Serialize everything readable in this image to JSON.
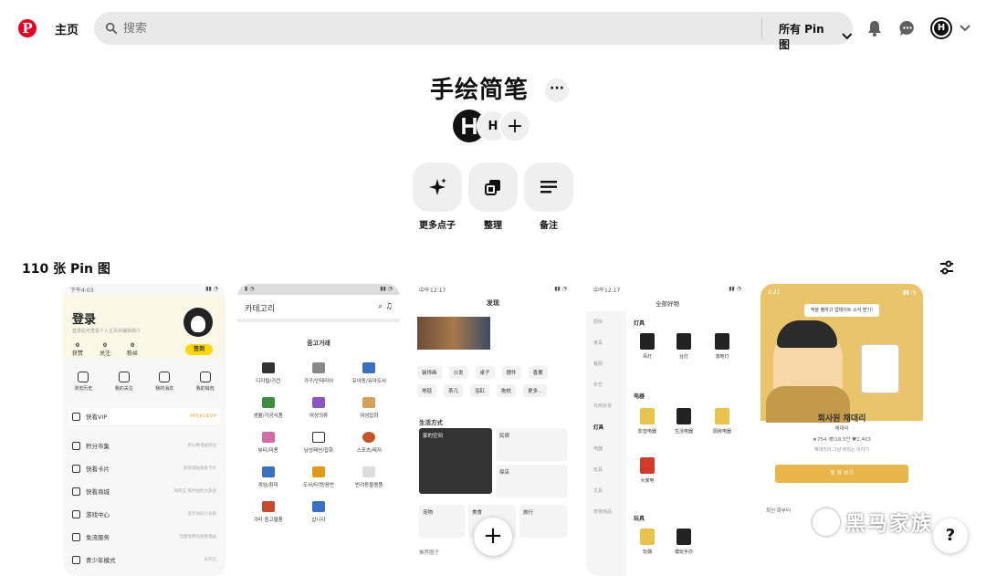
{
  "header": {
    "logo": "P",
    "home_label": "主页",
    "search_placeholder": "搜索",
    "filter_label": "所有 Pin 图",
    "avatar_initial": "H"
  },
  "board": {
    "title": "手绘简笔",
    "more_label": "···",
    "collaborators": [
      "H",
      "H"
    ],
    "add_collaborator": "+",
    "actions": [
      {
        "label": "更多点子",
        "icon": "sparkle-icon"
      },
      {
        "label": "整理",
        "icon": "organize-icon"
      },
      {
        "label": "备注",
        "icon": "notes-icon"
      }
    ],
    "pin_count": "110 张 Pin 图"
  },
  "pins": {
    "p1": {
      "status": "下午4:03",
      "title": "登录",
      "subtitle": "登录后可查看个人主页并编辑简介",
      "sign_label": "签到",
      "stats": [
        {
          "v": "0",
          "l": "获赞"
        },
        {
          "v": "0",
          "l": "关注"
        },
        {
          "v": "0",
          "l": "粉丝"
        }
      ],
      "shortcuts": [
        "浏览历史",
        "我的关注",
        "我的消息",
        "我的钱包"
      ],
      "vip_label": "快看VIP",
      "vip_hint": "99元买1年VIP",
      "menu": [
        {
          "label": "积分市集",
          "hint": "积分换漫画周边"
        },
        {
          "label": "快看卡片",
          "hint": "解锁漫画独家卡片"
        },
        {
          "label": "快看商城",
          "hint": "每周五 限时福利大放送"
        },
        {
          "label": "游戏中心",
          "hint": "宣炸你的小长假"
        },
        {
          "label": "免流服务",
          "hint": "流量免费任性看漫画"
        },
        {
          "label": "青少年模式",
          "hint": "未开启"
        }
      ]
    },
    "p2": {
      "title": "카테고리",
      "section": "중고거래",
      "items": [
        "디지털/가전",
        "가구/인테리어",
        "유아동/유아도서",
        "생활/가공식품",
        "여성의류",
        "여성잡화",
        "뷰티/미용",
        "남성패션/잡화",
        "스포츠/레저",
        "게임/취미",
        "도서/티켓/음반",
        "반려동물용품",
        "기타 중고물품",
        "삽니다"
      ]
    },
    "p3": {
      "status": "中午12:17",
      "title": "发现",
      "chips": [
        "装饰画",
        "沙发",
        "桌子",
        "摆件",
        "香薰",
        "地毯",
        "茶几",
        "浴缸",
        "拖枕",
        "更多..."
      ],
      "section": "生活方式",
      "big_card": "家的空间",
      "cards": [
        "民宿",
        "探店",
        "宠物",
        "美食",
        "旅行"
      ],
      "fab": "+",
      "foot": "推荐圈子"
    },
    "p4": {
      "status": "中午12:17",
      "title": "全部好物",
      "side": [
        "厨房",
        "家具",
        "餐厨",
        "布艺",
        "日用杂货",
        "灯具",
        "电器",
        "玩具",
        "文具",
        "宠物用品"
      ],
      "active_side": "灯具",
      "group1": "灯具",
      "lamps": [
        "吊灯",
        "台灯",
        "落地灯"
      ],
      "group2": "电器",
      "appliances": [
        "影音电器",
        "生活电器",
        "厨房电器",
        "大家电"
      ],
      "group3": "玩具",
      "toys": [
        "玩偶",
        "模玩手办"
      ]
    },
    "p5": {
      "status": "2:21",
      "tooltip": "적을 펌하고 업데이트 소식 받기!",
      "name": "회사원 채대리",
      "role": "채대리",
      "meta": "★754 👁18.5만 ♥2,403",
      "desc": "채대리의 그냥 비리는 이야기",
      "button": "첫 화 보기",
      "recent": "최신 화부터"
    }
  },
  "watermark": "黑马家族",
  "help": "?"
}
